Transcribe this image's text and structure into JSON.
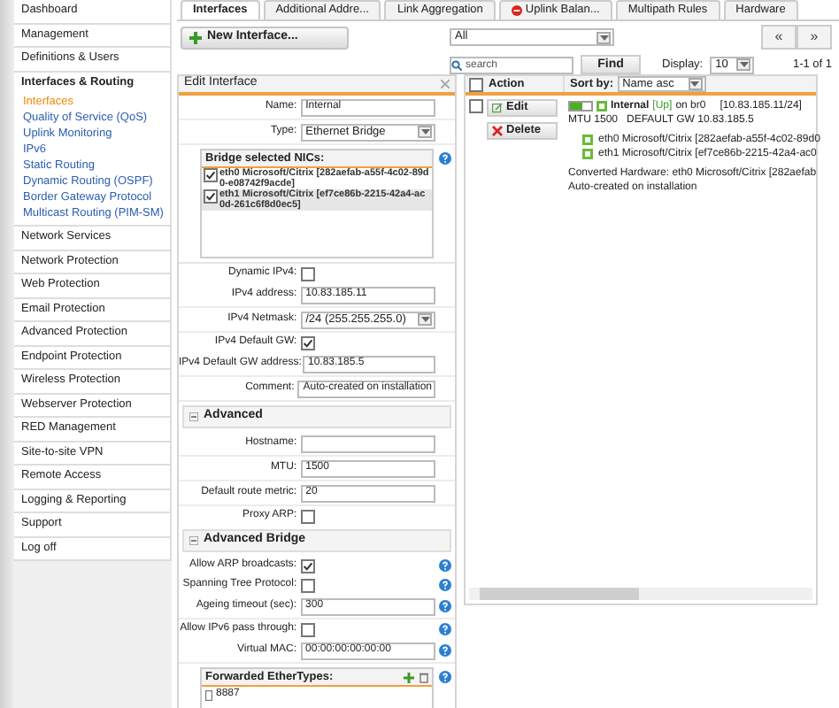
{
  "sidebar": {
    "items": [
      {
        "label": "Dashboard",
        "expanded": false
      },
      {
        "label": "Management",
        "expanded": false
      },
      {
        "label": "Definitions & Users",
        "expanded": false
      },
      {
        "label": "Interfaces & Routing",
        "expanded": true,
        "children": [
          {
            "label": "Interfaces",
            "selected": true
          },
          {
            "label": "Quality of Service (QoS)",
            "selected": false
          },
          {
            "label": "Uplink Monitoring",
            "selected": false
          },
          {
            "label": "IPv6",
            "selected": false
          },
          {
            "label": "Static Routing",
            "selected": false
          },
          {
            "label": "Dynamic Routing (OSPF)",
            "selected": false
          },
          {
            "label": "Border Gateway Protocol",
            "selected": false
          },
          {
            "label": "Multicast Routing (PIM-SM)",
            "selected": false
          }
        ]
      },
      {
        "label": "Network Services",
        "expanded": false
      },
      {
        "label": "Network Protection",
        "expanded": false
      },
      {
        "label": "Web Protection",
        "expanded": false
      },
      {
        "label": "Email Protection",
        "expanded": false
      },
      {
        "label": "Advanced Protection",
        "expanded": false
      },
      {
        "label": "Endpoint Protection",
        "expanded": false
      },
      {
        "label": "Wireless Protection",
        "expanded": false
      },
      {
        "label": "Webserver Protection",
        "expanded": false
      },
      {
        "label": "RED Management",
        "expanded": false
      },
      {
        "label": "Site-to-site VPN",
        "expanded": false
      },
      {
        "label": "Remote Access",
        "expanded": false
      },
      {
        "label": "Logging & Reporting",
        "expanded": false
      },
      {
        "label": "Support",
        "expanded": false
      },
      {
        "label": "Log off",
        "expanded": false
      }
    ]
  },
  "tabs": [
    {
      "label": "Interfaces",
      "selected": true,
      "warning": false
    },
    {
      "label": "Additional Addre...",
      "selected": false,
      "warning": false
    },
    {
      "label": "Link Aggregation",
      "selected": false,
      "warning": false
    },
    {
      "label": "Uplink Balan...",
      "selected": false,
      "warning": true
    },
    {
      "label": "Multipath Rules",
      "selected": false,
      "warning": false
    },
    {
      "label": "Hardware",
      "selected": false,
      "warning": false
    }
  ],
  "toolbar": {
    "new_button": "New Interface...",
    "filter": "All",
    "search_placeholder": "search",
    "find_button": "Find",
    "display_label": "Display:",
    "display_value": "10",
    "prev": "«",
    "next": "»",
    "count": "1-1 of 1"
  },
  "edit_panel": {
    "title": "Edit Interface",
    "rows": [
      {
        "kind": "text",
        "label": "Name:",
        "value": "Internal",
        "help": false
      },
      {
        "kind": "select",
        "label": "Type:",
        "value": "Ethernet Bridge",
        "help": false
      },
      {
        "kind": "nics",
        "title": "Bridge selected NICs:",
        "help": true,
        "items": [
          {
            "label": "eth0 Microsoft/Citrix [282aefab-a55f-4c02-89d0-e08742f9acde]",
            "checked": true
          },
          {
            "label": "eth1 Microsoft/Citrix [ef7ce86b-2215-42a4-ac0d-261c6f8d0ec5]",
            "checked": true
          }
        ]
      },
      {
        "kind": "checkbox",
        "label": "Dynamic IPv4:",
        "checked": false,
        "help": false
      },
      {
        "kind": "text",
        "label": "IPv4 address:",
        "value": "10.83.185.11",
        "help": false
      },
      {
        "kind": "select",
        "label": "IPv4 Netmask:",
        "value": "/24 (255.255.255.0)",
        "help": false
      },
      {
        "kind": "checkbox",
        "label": "IPv4 Default GW:",
        "checked": true,
        "help": false
      },
      {
        "kind": "text",
        "label": "IPv4 Default GW address:",
        "value": "10.83.185.5",
        "help": false
      },
      {
        "kind": "text",
        "label": "Comment:",
        "value": "Auto-created on installation",
        "help": false
      },
      {
        "kind": "section",
        "label": "Advanced"
      },
      {
        "kind": "text",
        "label": "Hostname:",
        "help": false
      },
      {
        "kind": "text",
        "label": "MTU:",
        "value": "1500",
        "help": false
      },
      {
        "kind": "text",
        "label": "Default route metric:",
        "value": "20",
        "help": false
      },
      {
        "kind": "checkbox",
        "label": "Proxy ARP:",
        "checked": false,
        "help": false
      },
      {
        "kind": "section",
        "label": "Advanced Bridge"
      },
      {
        "kind": "checkbox",
        "label": "Allow ARP broadcasts:",
        "checked": true,
        "help": true
      },
      {
        "kind": "checkbox",
        "label": "Spanning Tree Protocol:",
        "checked": false,
        "help": true
      },
      {
        "kind": "text",
        "label": "Ageing timeout (sec):",
        "value": "300",
        "help": true
      },
      {
        "kind": "checkbox",
        "label": "Allow IPv6 pass through:",
        "checked": false,
        "help": true
      },
      {
        "kind": "text",
        "label": "Virtual MAC:",
        "value": "00:00:00:00:00:00",
        "help": true
      },
      {
        "kind": "list",
        "title": "Forwarded EtherTypes:",
        "help": true,
        "items": [
          "8887"
        ]
      }
    ]
  },
  "list_panel": {
    "all_checked": false,
    "action_label": "Action",
    "sort_label": "Sort by:",
    "sort_value": "Name asc",
    "rows": [
      {
        "checked": false,
        "edit": "Edit",
        "delete": "Delete",
        "enabled": true,
        "name": "Internal",
        "status": "[Up]",
        "device": "on br0",
        "address": "[10.83.185.11/24]",
        "details": "MTU 1500   DEFAULT GW 10.83.185.5",
        "nics": [
          "eth0 Microsoft/Citrix [282aefab-a55f-4c02-89d0",
          "eth1 Microsoft/Citrix [ef7ce86b-2215-42a4-ac0"
        ],
        "hardware": "Converted Hardware: eth0 Microsoft/Citrix [282aefab",
        "comment": "Auto-created on installation"
      }
    ]
  }
}
